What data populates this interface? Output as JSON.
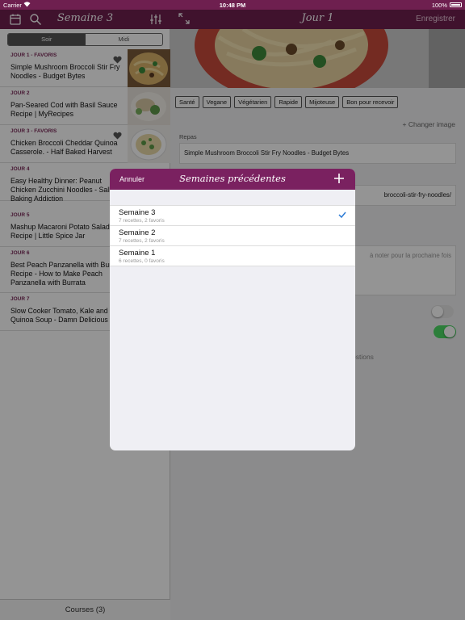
{
  "status_bar": {
    "carrier": "Carrier",
    "time": "10:48 PM",
    "battery": "100%"
  },
  "left_nav": {
    "title": "Semaine 3",
    "icons": [
      "calendar-icon",
      "search-icon",
      "sliders-icon"
    ]
  },
  "right_nav": {
    "title": "Jour 1",
    "save_label": "Enregistrer",
    "icons": [
      "expand-icon"
    ]
  },
  "segment": {
    "options": [
      "Soir",
      "Midi"
    ],
    "selected": "Soir"
  },
  "days": [
    {
      "label": "JOUR 1 - FAVORIS",
      "meal": "Simple Mushroom Broccoli Stir Fry Noodles - Budget Bytes",
      "favorite": true
    },
    {
      "label": "JOUR 2",
      "meal": "Pan-Seared Cod with Basil Sauce Recipe | MyRecipes",
      "favorite": false
    },
    {
      "label": "JOUR 3 - FAVORIS",
      "meal": "Chicken Broccoli Cheddar Quinoa Casserole. - Half Baked Harvest",
      "favorite": true
    },
    {
      "label": "JOUR 4",
      "meal": "Easy Healthy Dinner: Peanut Chicken Zucchini Noodles - Sally's Baking Addiction",
      "favorite": false
    },
    {
      "label": "JOUR 5",
      "meal": "Mashup Macaroni Potato Salad Recipe | Little Spice Jar",
      "favorite": false
    },
    {
      "label": "JOUR 6",
      "meal": "Best Peach Panzanella with Burrata Recipe - How to Make Peach Panzanella with Burrata",
      "favorite": false
    },
    {
      "label": "JOUR 7",
      "meal": "Slow Cooker Tomato, Kale and Quinoa Soup - Damn Delicious",
      "favorite": false
    }
  ],
  "courses_label": "Courses (3)",
  "detail": {
    "tags": [
      "Santé",
      "Vegane",
      "Végétarien",
      "Rapide",
      "Mijoteuse",
      "Bon pour recevoir"
    ],
    "change_image": "+ Changer image",
    "repas_label": "Repas",
    "repas_value": "Simple Mushroom Broccoli Stir Fry Noodles - Budget Bytes",
    "url_value": "broccoli-stir-fry-noodles/",
    "notes_placeholder": "à noter pour la prochaine fois",
    "suggestions_fragment": "estions"
  },
  "modal": {
    "cancel_label": "Annuler",
    "title": "Semaines précédentes",
    "add_icon": "plus-icon",
    "weeks": [
      {
        "name": "Semaine 3",
        "summary": "7 recettes, 2 favoris",
        "selected": true
      },
      {
        "name": "Semaine 2",
        "summary": "7 recettes, 2 favoris",
        "selected": false
      },
      {
        "name": "Semaine 1",
        "summary": "6 recettes, 0 favoris",
        "selected": false
      }
    ]
  },
  "colors": {
    "brand": "#6e1f4f",
    "modal_header": "#7a2160",
    "toggle_on": "#4cd964",
    "checkmark": "#2a7ad6"
  }
}
